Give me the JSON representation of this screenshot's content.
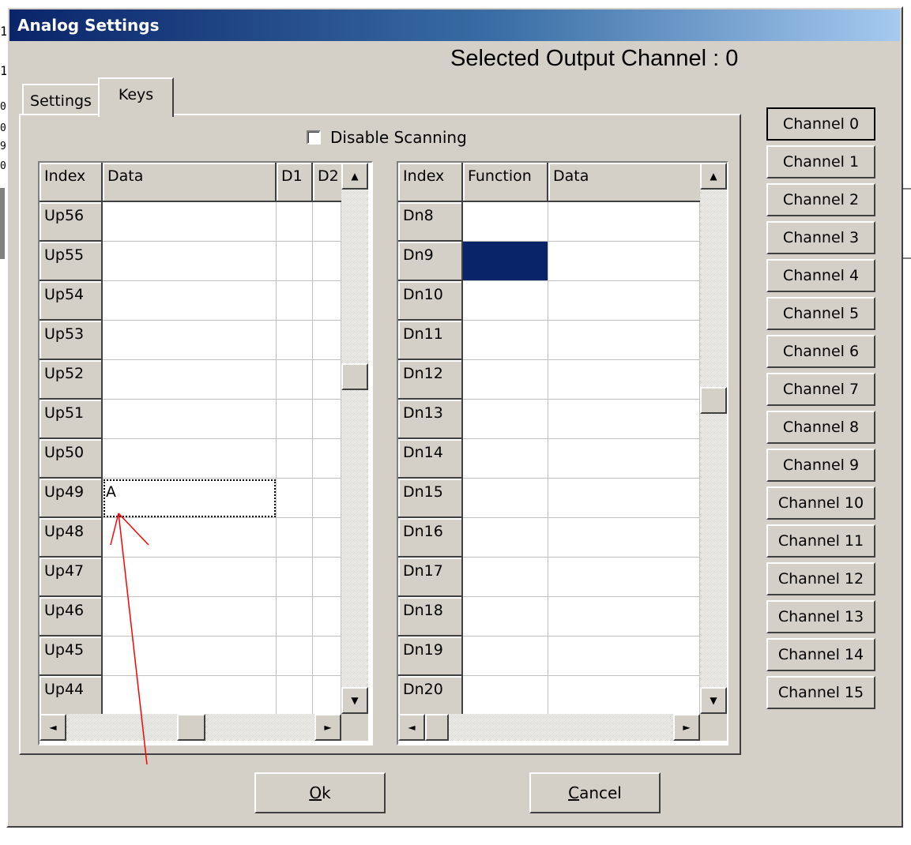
{
  "window": {
    "title": "Analog Settings",
    "selected_channel_text": "Selected Output Channel :  0"
  },
  "background_fragments": [
    "1",
    "1",
    "0",
    "0",
    "9",
    "0"
  ],
  "tabs": [
    {
      "label": "Settings"
    },
    {
      "label": "Keys"
    }
  ],
  "keys_tab": {
    "disable_scanning_label": "Disable Scanning",
    "disable_scanning_checked": false,
    "left_grid": {
      "columns": [
        "Index",
        "Data",
        "D1",
        "D2"
      ],
      "rows": [
        {
          "index": "Up56",
          "data": ""
        },
        {
          "index": "Up55",
          "data": ""
        },
        {
          "index": "Up54",
          "data": ""
        },
        {
          "index": "Up53",
          "data": ""
        },
        {
          "index": "Up52",
          "data": ""
        },
        {
          "index": "Up51",
          "data": ""
        },
        {
          "index": "Up50",
          "data": ""
        },
        {
          "index": "Up49",
          "data": "A"
        },
        {
          "index": "Up48",
          "data": ""
        },
        {
          "index": "Up47",
          "data": ""
        },
        {
          "index": "Up46",
          "data": ""
        },
        {
          "index": "Up45",
          "data": ""
        },
        {
          "index": "Up44",
          "data": ""
        }
      ],
      "focused_row": 7
    },
    "right_grid": {
      "columns": [
        "Index",
        "Function",
        "Data"
      ],
      "rows": [
        {
          "index": "Dn8",
          "function": "",
          "data": ""
        },
        {
          "index": "Dn9",
          "function": "",
          "data": ""
        },
        {
          "index": "Dn10",
          "function": "",
          "data": ""
        },
        {
          "index": "Dn11",
          "function": "",
          "data": ""
        },
        {
          "index": "Dn12",
          "function": "",
          "data": ""
        },
        {
          "index": "Dn13",
          "function": "",
          "data": ""
        },
        {
          "index": "Dn14",
          "function": "",
          "data": ""
        },
        {
          "index": "Dn15",
          "function": "",
          "data": ""
        },
        {
          "index": "Dn16",
          "function": "",
          "data": ""
        },
        {
          "index": "Dn17",
          "function": "",
          "data": ""
        },
        {
          "index": "Dn18",
          "function": "",
          "data": ""
        },
        {
          "index": "Dn19",
          "function": "",
          "data": ""
        },
        {
          "index": "Dn20",
          "function": "",
          "data": ""
        }
      ],
      "selected_row": 1
    }
  },
  "channels": [
    "Channel 0",
    "Channel 1",
    "Channel 2",
    "Channel 3",
    "Channel 4",
    "Channel 5",
    "Channel 6",
    "Channel 7",
    "Channel 8",
    "Channel 9",
    "Channel 10",
    "Channel 11",
    "Channel 12",
    "Channel 13",
    "Channel 14",
    "Channel 15"
  ],
  "active_channel": 0,
  "buttons": {
    "ok_mnemonic": "O",
    "ok_rest": "k",
    "cancel_mnemonic": "C",
    "cancel_rest": "ancel"
  },
  "icons": {
    "scroll_up": "▲",
    "scroll_down": "▼",
    "scroll_left": "◄",
    "scroll_right": "►"
  },
  "colors": {
    "title_start": "#0a246a",
    "title_end": "#a6caf0",
    "dialog_face": "#d4d0c8",
    "selection": "#0a246a",
    "annotation": "#ff0000"
  }
}
